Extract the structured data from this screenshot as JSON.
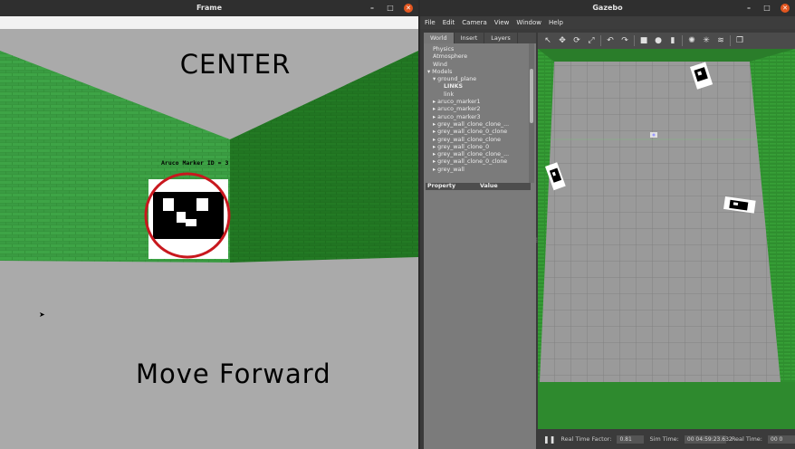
{
  "frame_window": {
    "title": "Frame",
    "center_text": "CENTER",
    "aruco_text": "Aruco Marker ID = 3",
    "move_text": "Move Forward"
  },
  "gazebo_window": {
    "title": "Gazebo",
    "menu": [
      "File",
      "Edit",
      "Camera",
      "View",
      "Window",
      "Help"
    ],
    "tabs": [
      "World",
      "Insert",
      "Layers"
    ],
    "tree": [
      {
        "label": "Physics",
        "indent": 1,
        "arrow": ""
      },
      {
        "label": "Atmosphere",
        "indent": 1,
        "arrow": ""
      },
      {
        "label": "Wind",
        "indent": 1,
        "arrow": ""
      },
      {
        "label": "Models",
        "indent": 0,
        "arrow": "▾"
      },
      {
        "label": "ground_plane",
        "indent": 1,
        "arrow": "▾"
      },
      {
        "label": "LINKS",
        "indent": 3,
        "arrow": ""
      },
      {
        "label": "link",
        "indent": 3,
        "arrow": ""
      },
      {
        "label": "aruco_marker1",
        "indent": 1,
        "arrow": "▸"
      },
      {
        "label": "aruco_marker2",
        "indent": 1,
        "arrow": "▸"
      },
      {
        "label": "aruco_marker3",
        "indent": 1,
        "arrow": "▸"
      },
      {
        "label": "grey_wall_clone_clone_...",
        "indent": 1,
        "arrow": "▸"
      },
      {
        "label": "grey_wall_clone_0_clone",
        "indent": 1,
        "arrow": "▸"
      },
      {
        "label": "grey_wall_clone_clone",
        "indent": 1,
        "arrow": "▸"
      },
      {
        "label": "grey_wall_clone_0",
        "indent": 1,
        "arrow": "▸"
      },
      {
        "label": "grey_wall_clone_clone_...",
        "indent": 1,
        "arrow": "▸"
      },
      {
        "label": "grey_wall_clone_0_clone",
        "indent": 1,
        "arrow": "▸"
      },
      {
        "label": "grey_wall",
        "indent": 1,
        "arrow": "▸"
      }
    ],
    "property_header": [
      "Property",
      "Value"
    ],
    "status": {
      "rtf_label": "Real Time Factor:",
      "rtf_value": "0.81",
      "sim_label": "Sim Time:",
      "sim_value": "00 04:59:23.632",
      "real_label": "Real Time:",
      "real_value": "00 0"
    }
  },
  "colors": {
    "wall_green": "#2f8a2a",
    "wall_green_dark": "#1f6f1f",
    "floor_grey": "#a9a9a9",
    "marker_ring": "#c8181e",
    "gazebo_bg": "#3a3a3a"
  }
}
